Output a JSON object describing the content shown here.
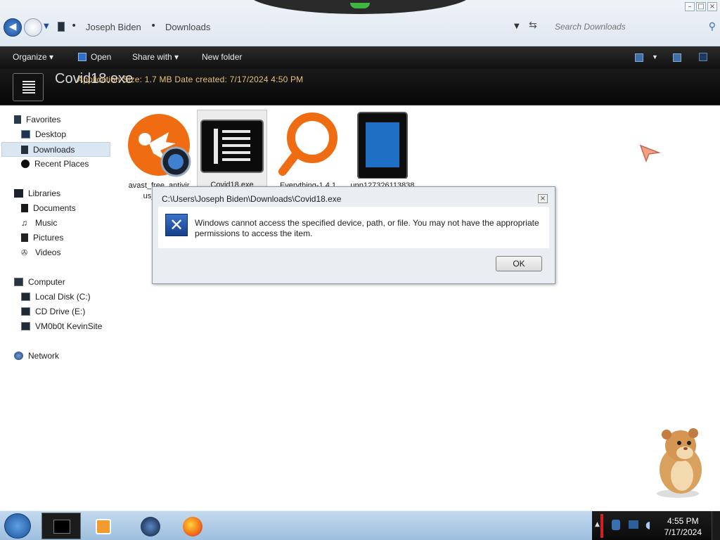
{
  "address_bar": {
    "parts": [
      "Joseph Biden",
      "Downloads"
    ],
    "search_placeholder": "Search Downloads"
  },
  "toolbar": {
    "organize": "Organize",
    "open": "Open",
    "share_with": "Share with",
    "new_folder": "New folder"
  },
  "details_pane": {
    "file_name": "Covid18.exe",
    "meta": "Application   Size: 1.7 MB   Date created: 7/17/2024 4:50 PM"
  },
  "nav": {
    "favorites": "Favorites",
    "desktop": "Desktop",
    "downloads": "Downloads",
    "recent_places": "Recent Places",
    "libraries": "Libraries",
    "documents": "Documents",
    "music": "Music",
    "pictures": "Pictures",
    "videos": "Videos",
    "computer": "Computer",
    "local_disk": "Local Disk (C:)",
    "cd_drive": "CD Drive (E:)",
    "network_drive": "VM0b0t KevinSite",
    "network": "Network"
  },
  "files": [
    {
      "name_line1": "avast_free_antivir",
      "name_line2": "us_setup",
      "icon": "avast-icon"
    },
    {
      "name_line1": "Covid18.exe",
      "name_line2": "",
      "icon": "exe-icon"
    },
    {
      "name_line1": "Everything-1.4.1",
      "name_line2": "",
      "icon": "magnifier-icon"
    },
    {
      "name_line1": "unp127326113838",
      "name_line2": "",
      "icon": "tablet-icon"
    }
  ],
  "dialog": {
    "title": "C:\\Users\\Joseph Biden\\Downloads\\Covid18.exe",
    "message": "Windows cannot access the specified device, path, or file.  You may not have the appropriate permissions to access the item.",
    "ok": "OK"
  },
  "taskbar": {
    "time": "4:55 PM",
    "date": "7/17/2024"
  },
  "colors": {
    "toolbar_dark": "#111111",
    "details_text": "#e8c27a",
    "taskbar_blue": "#9ebfdf",
    "selection": "#dbe6f3"
  }
}
